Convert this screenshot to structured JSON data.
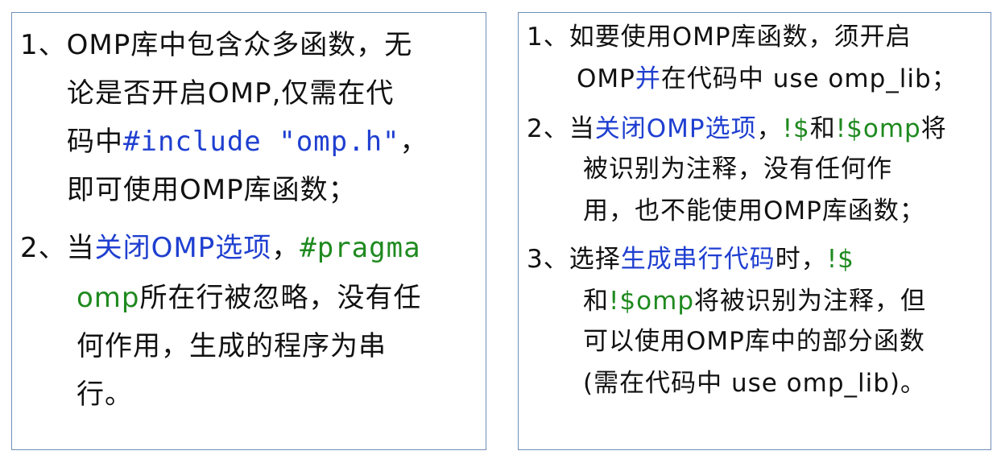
{
  "left_panel": {
    "items": [
      {
        "lines": [
          [
            "1、OMP库中包含众多函数，无"
          ],
          [
            "论是否开启OMP,仅需在代"
          ],
          [
            "码中",
            "#include \"omp.h\"",
            "，"
          ],
          [
            "即可使用OMP库函数；"
          ]
        ]
      },
      {
        "lines": [
          [
            "2、当",
            "关闭OMP选项",
            "，",
            "#pragma"
          ],
          [
            "omp",
            "所在行被忽略，没有任"
          ],
          [
            "何作用，生成的程序为串"
          ],
          [
            "行。"
          ]
        ]
      }
    ]
  },
  "right_panel": {
    "items": [
      {
        "lines": [
          [
            "1、如要使用OMP库函数，须开启"
          ],
          [
            "OMP",
            "并",
            "在代码中 use omp_lib；"
          ]
        ]
      },
      {
        "lines": [
          [
            "2、当",
            "关闭OMP选项",
            "，",
            "!$",
            "和",
            "!$omp",
            "将"
          ],
          [
            "被识别为注释，没有任何作"
          ],
          [
            "用，也不能使用OMP库函数；"
          ]
        ]
      },
      {
        "lines": [
          [
            "3、选择",
            "生成串行代码",
            "时，",
            "!$"
          ],
          [
            "和",
            "!$omp",
            "将被识别为注释，但"
          ],
          [
            "可以使用OMP库中的部分函数"
          ],
          [
            "(需在代码中 use omp_lib)。"
          ]
        ]
      }
    ]
  },
  "colors": {
    "blue": "#1f3fd0",
    "green": "#1f8a1f",
    "border": "#6f8fb8",
    "text": "#111111"
  }
}
